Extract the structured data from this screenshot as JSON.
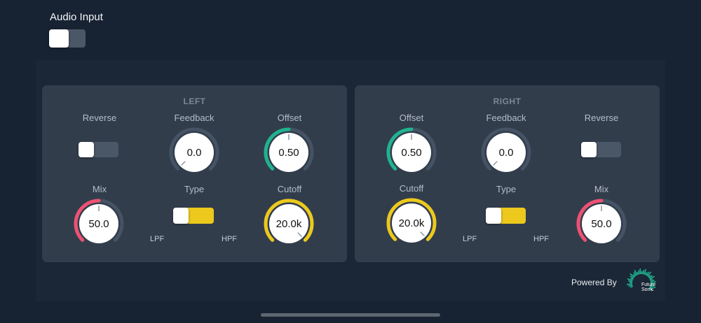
{
  "audio_input": {
    "label": "Audio Input",
    "enabled": false
  },
  "left": {
    "title": "LEFT",
    "reverse": {
      "label": "Reverse",
      "enabled": false
    },
    "feedback": {
      "label": "Feedback",
      "value": "0.0",
      "level": 0.0,
      "color": "#455364"
    },
    "offset": {
      "label": "Offset",
      "value": "0.50",
      "level": 0.5,
      "color": "#1fb38f"
    },
    "mix": {
      "label": "Mix",
      "value": "50.0",
      "level": 0.5,
      "color": "#ee5173"
    },
    "type": {
      "label": "Type",
      "low": "LPF",
      "high": "HPF",
      "selected": "LPF",
      "color": "#ecc91c"
    },
    "cutoff": {
      "label": "Cutoff",
      "value": "20.0k",
      "level": 1.0,
      "color": "#ecc91c"
    }
  },
  "right": {
    "title": "RIGHT",
    "offset": {
      "label": "Offset",
      "value": "0.50",
      "level": 0.5,
      "color": "#1fb38f"
    },
    "feedback": {
      "label": "Feedback",
      "value": "0.0",
      "level": 0.0,
      "color": "#455364"
    },
    "reverse": {
      "label": "Reverse",
      "enabled": false
    },
    "cutoff": {
      "label": "Cutoff",
      "value": "20.0k",
      "level": 1.0,
      "color": "#ecc91c"
    },
    "type": {
      "label": "Type",
      "low": "LPF",
      "high": "HPF",
      "selected": "LPF",
      "color": "#ecc91c"
    },
    "mix": {
      "label": "Mix",
      "value": "50.0",
      "level": 0.5,
      "color": "#ee5173"
    }
  },
  "footer": {
    "powered_by": "Powered By",
    "logo_text_1": "Future",
    "logo_text_2": "Sonic",
    "logo_color": "#1fb38f"
  }
}
